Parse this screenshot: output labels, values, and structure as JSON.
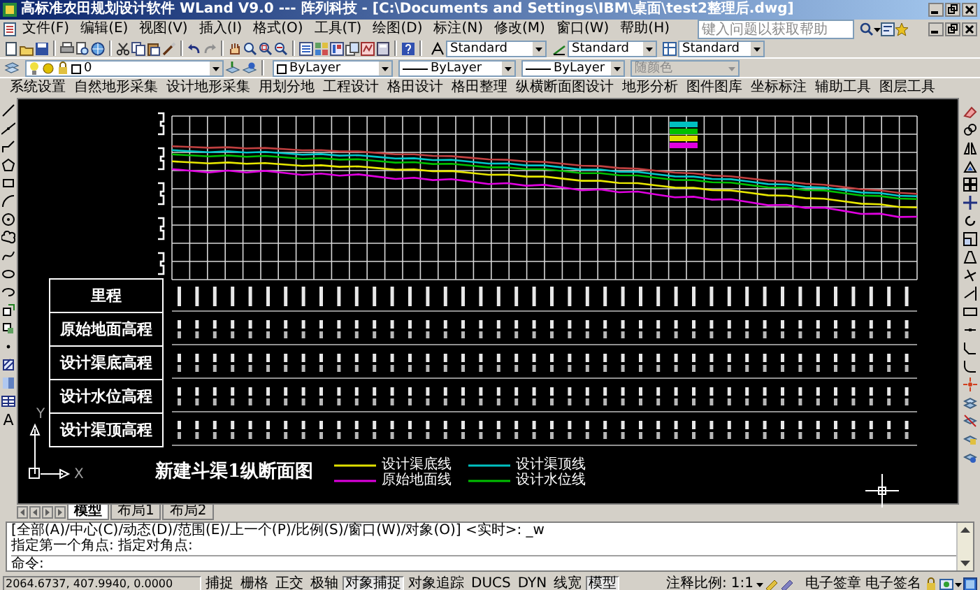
{
  "window": {
    "title": "高标准农田规划设计软件 WLand V9.0 --- 阵列科技 - [C:\\Documents and Settings\\IBM\\桌面\\test2整理后.dwg]"
  },
  "menu": [
    "文件(F)",
    "编辑(E)",
    "视图(V)",
    "插入(I)",
    "格式(O)",
    "工具(T)",
    "绘图(D)",
    "标注(N)",
    "修改(M)",
    "窗口(W)",
    "帮助(H)"
  ],
  "help_search": {
    "placeholder": "键入问题以获取帮助"
  },
  "styles": [
    "Standard",
    "Standard",
    "Standard"
  ],
  "layer": {
    "value": "0"
  },
  "properties": [
    {
      "kind": "color",
      "value": "ByLayer",
      "disabled": false
    },
    {
      "kind": "linetype",
      "value": "ByLayer",
      "disabled": false
    },
    {
      "kind": "lineweight",
      "value": "ByLayer",
      "disabled": false
    },
    {
      "kind": "plotstyle",
      "value": "随颜色",
      "disabled": true
    }
  ],
  "tools": [
    "系统设置",
    "自然地形采集",
    "设计地形采集",
    "用划分地",
    "工程设计",
    "格田设计",
    "格田整理",
    "纵横断面图设计",
    "地形分析",
    "图件图库",
    "坐标标注",
    "辅助工具",
    "图层工具"
  ],
  "left_toolbar": {
    "text_tool": "A"
  },
  "profile": {
    "row_labels": [
      "里程",
      "原始地面高程",
      "设计渠底高程",
      "设计水位高程",
      "设计渠顶高程"
    ],
    "title": "新建斗渠1纵断面图",
    "legend": [
      {
        "label": "设计渠底线",
        "color": "#e0e000"
      },
      {
        "label": "设计渠顶线",
        "color": "#00c0c0"
      },
      {
        "label": "原始地面线",
        "color": "#e000e0"
      },
      {
        "label": "设计水位线",
        "color": "#00c000"
      }
    ]
  },
  "ucs": {
    "y_label": "Y",
    "x_label": "X"
  },
  "layout_tabs": [
    {
      "label": "模型",
      "selected": true
    },
    {
      "label": "布局1",
      "selected": false
    },
    {
      "label": "布局2",
      "selected": false
    }
  ],
  "command": {
    "history": [
      "[全部(A)/中心(C)/动态(D)/范围(E)/上一个(P)/比例(S)/窗口(W)/对象(O)] <实时>: _w",
      "指定第一个角点: 指定对角点:"
    ],
    "prompt": "命令:"
  },
  "status": {
    "coords": "2064.6737, 407.9940, 0.0000",
    "toggles": [
      {
        "label": "捕捉",
        "on": false
      },
      {
        "label": "栅格",
        "on": false
      },
      {
        "label": "正交",
        "on": false
      },
      {
        "label": "极轴",
        "on": false
      },
      {
        "label": "对象捕捉",
        "on": true
      },
      {
        "label": "对象追踪",
        "on": false
      },
      {
        "label": "DUCS",
        "on": false
      },
      {
        "label": "DYN",
        "on": false
      },
      {
        "label": "线宽",
        "on": false
      },
      {
        "label": "模型",
        "on": true
      }
    ],
    "scale_label": "注释比例:",
    "scale": "1:1",
    "buttons": [
      "电子签章",
      "电子签名"
    ]
  }
}
